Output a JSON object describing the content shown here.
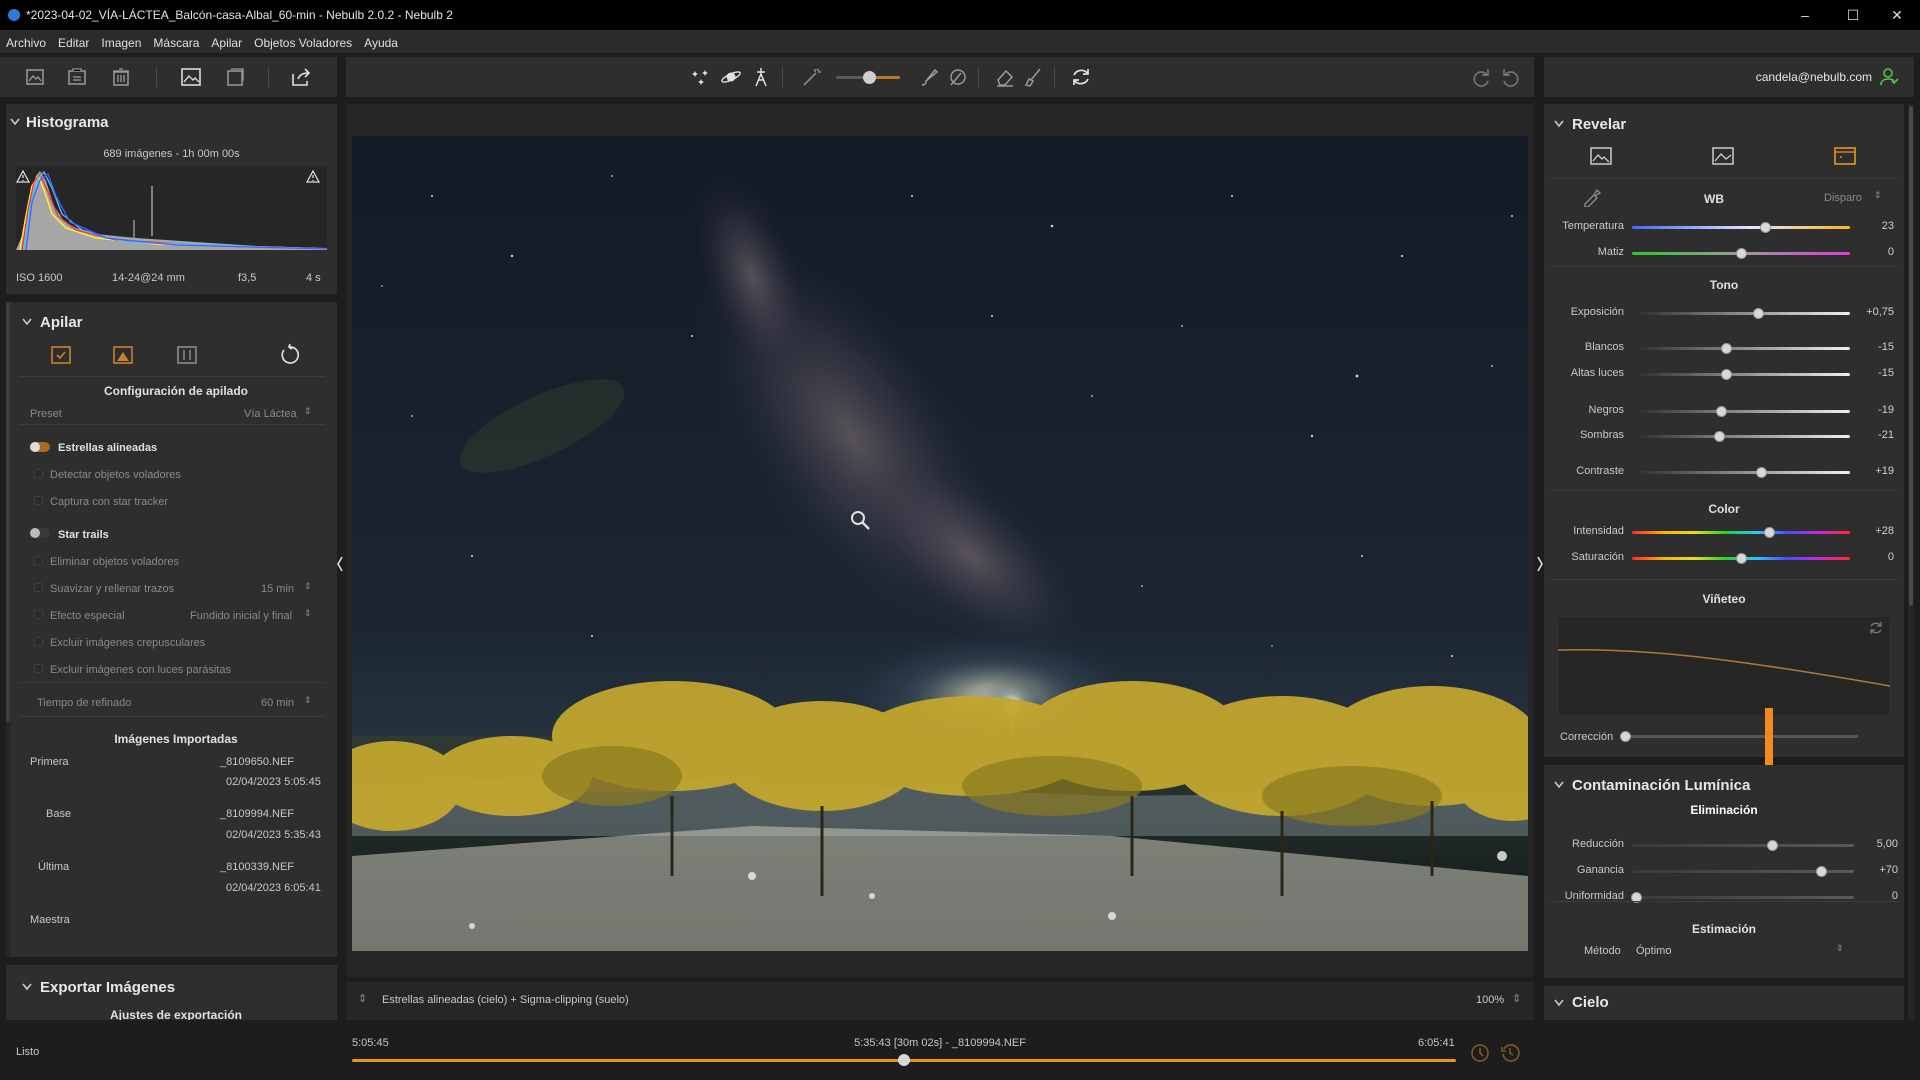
{
  "window": {
    "title": "*2023-04-02_VÍA-LÁCTEA_Balcón-casa-Albal_60-min - Nebulb 2.0.2 - Nebulb 2",
    "minimize": "–",
    "maximize": "☐",
    "close": "✕"
  },
  "menu": [
    "Archivo",
    "Editar",
    "Imagen",
    "Máscara",
    "Apilar",
    "Objetos Voladores",
    "Ayuda"
  ],
  "account": {
    "email": "candela@nebulb.com"
  },
  "histogram": {
    "title": "Histograma",
    "summary": "689 imágenes - 1h 00m 00s",
    "iso": "ISO 1600",
    "lens": "14-24@24 mm",
    "aperture": "f3,5",
    "exposure": "4 s"
  },
  "stack": {
    "title": "Apilar",
    "config_title": "Configuración de apilado",
    "preset_label": "Preset",
    "preset_value": "Vía Láctea",
    "aligned_stars": "Estrellas alineadas",
    "detect_flying": "Detectar objetos voladores",
    "star_tracker": "Captura con star tracker",
    "star_trails": "Star trails",
    "remove_flying": "Eliminar objetos voladores",
    "smooth_label": "Suavizar y rellenar trazos",
    "smooth_value": "15 min",
    "effect_label": "Efecto especial",
    "effect_value": "Fundido inicial y final",
    "exclude_twilight": "Excluir imágenes crepusculares",
    "exclude_parasitic": "Excluir imágenes con luces parásitas",
    "refine_label": "Tiempo de refinado",
    "refine_value": "60 min"
  },
  "imported": {
    "title": "Imágenes Importadas",
    "rows": [
      {
        "label": "Primera",
        "file": "_8109650.NEF",
        "date": "02/04/2023 5:05:45"
      },
      {
        "label": "Base",
        "file": "_8109994.NEF",
        "date": "02/04/2023 5:35:43"
      },
      {
        "label": "Última",
        "file": "_8100339.NEF",
        "date": "02/04/2023 6:05:41"
      },
      {
        "label": "Maestra",
        "file": "",
        "date": ""
      }
    ]
  },
  "export": {
    "title": "Exportar Imágenes",
    "subtitle": "Ajustes de exportación"
  },
  "status": {
    "text": "Listo"
  },
  "canvas": {
    "mode": "Estrellas alineadas (cielo) + Sigma-clipping (suelo)",
    "zoom": "100%"
  },
  "timeline": {
    "start": "5:05:45",
    "current": "5:35:43 [30m 02s] - _8109994.NEF",
    "end": "6:05:41",
    "position": 0.5
  },
  "develop": {
    "title": "Revelar",
    "wb_title": "WB",
    "wb_mode": "Disparo",
    "wb_sliders": [
      {
        "label": "Temperatura",
        "value": "23",
        "pos": 0.61
      },
      {
        "label": "Matiz",
        "value": "0",
        "pos": 0.5
      }
    ],
    "tone_title": "Tono",
    "tone_sliders": [
      {
        "label": "Exposición",
        "value": "+0,75",
        "pos": 0.58
      },
      {
        "label": "Blancos",
        "value": "-15",
        "pos": 0.43
      },
      {
        "label": "Altas luces",
        "value": "-15",
        "pos": 0.43
      },
      {
        "label": "Negros",
        "value": "-19",
        "pos": 0.41
      },
      {
        "label": "Sombras",
        "value": "-21",
        "pos": 0.4
      },
      {
        "label": "Contraste",
        "value": "+19",
        "pos": 0.59
      }
    ],
    "color_title": "Color",
    "color_sliders": [
      {
        "label": "Intensidad",
        "value": "+28",
        "pos": 0.63
      },
      {
        "label": "Saturación",
        "value": "0",
        "pos": 0.5
      }
    ],
    "vignette_title": "Viñeteo",
    "correction_label": "Corrección"
  },
  "light_pollution": {
    "title": "Contaminación Lumínica",
    "removal_title": "Eliminación",
    "sliders": [
      {
        "label": "Reducción",
        "value": "5,00",
        "pos": 0.63
      },
      {
        "label": "Ganancia",
        "value": "+70",
        "pos": 0.85
      },
      {
        "label": "Uniformidad",
        "value": "0",
        "pos": 0.02
      }
    ],
    "estimation_title": "Estimación",
    "method_label": "Método",
    "method_value": "Óptimo"
  },
  "sky": {
    "title": "Cielo"
  },
  "colors": {
    "accent": "#e8961e",
    "arrow": "#f08c1e",
    "active_icon": "#e8961e"
  }
}
